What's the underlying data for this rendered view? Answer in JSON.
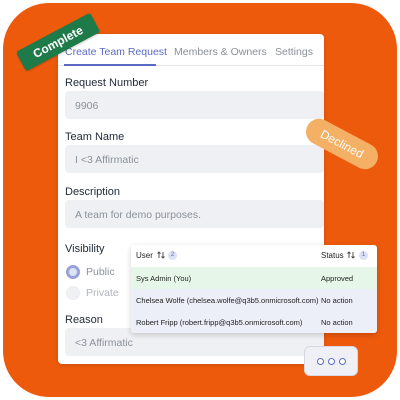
{
  "tabs": [
    {
      "label": "Create Team Request",
      "active": true
    },
    {
      "label": "Members & Owners",
      "active": false
    },
    {
      "label": "Settings",
      "active": false
    }
  ],
  "form": {
    "request_number": {
      "label": "Request Number",
      "value": "9906"
    },
    "team_name": {
      "label": "Team Name",
      "value": "I <3 Affirmatic"
    },
    "description": {
      "label": "Description",
      "value": "A team for demo purposes."
    },
    "visibility": {
      "label": "Visibility",
      "options": [
        {
          "label": "Public",
          "selected": true
        },
        {
          "label": "Private",
          "selected": false
        }
      ]
    },
    "reason": {
      "label": "Reason",
      "value": "<3 Affirmatic"
    }
  },
  "members_panel": {
    "user_header": "User",
    "user_count": "2",
    "status_header": "Status",
    "status_count": "1",
    "rows": [
      {
        "user": "Sys Admin (You)",
        "status": "Approved"
      },
      {
        "user": "Chelsea Wolfe (chelsea.wolfe@q3b5.onmicrosoft.com)",
        "status": "No action"
      },
      {
        "user": "Robert Fripp (robert.fripp@q3b5.onmicrosoft.com)",
        "status": "No action"
      }
    ]
  },
  "badges": {
    "complete": "Complete",
    "declined": "Declined"
  },
  "colors": {
    "tile": "#ee5a0c",
    "accent": "#5b6bc4",
    "complete_badge": "#1f7a4a",
    "declined_badge": "#f4b065",
    "approved_row": "#e6f6e9",
    "pending_row": "#eceef8"
  },
  "icons": {
    "sort": "sort-arrows-icon",
    "more": "more-horizontal-icon"
  }
}
